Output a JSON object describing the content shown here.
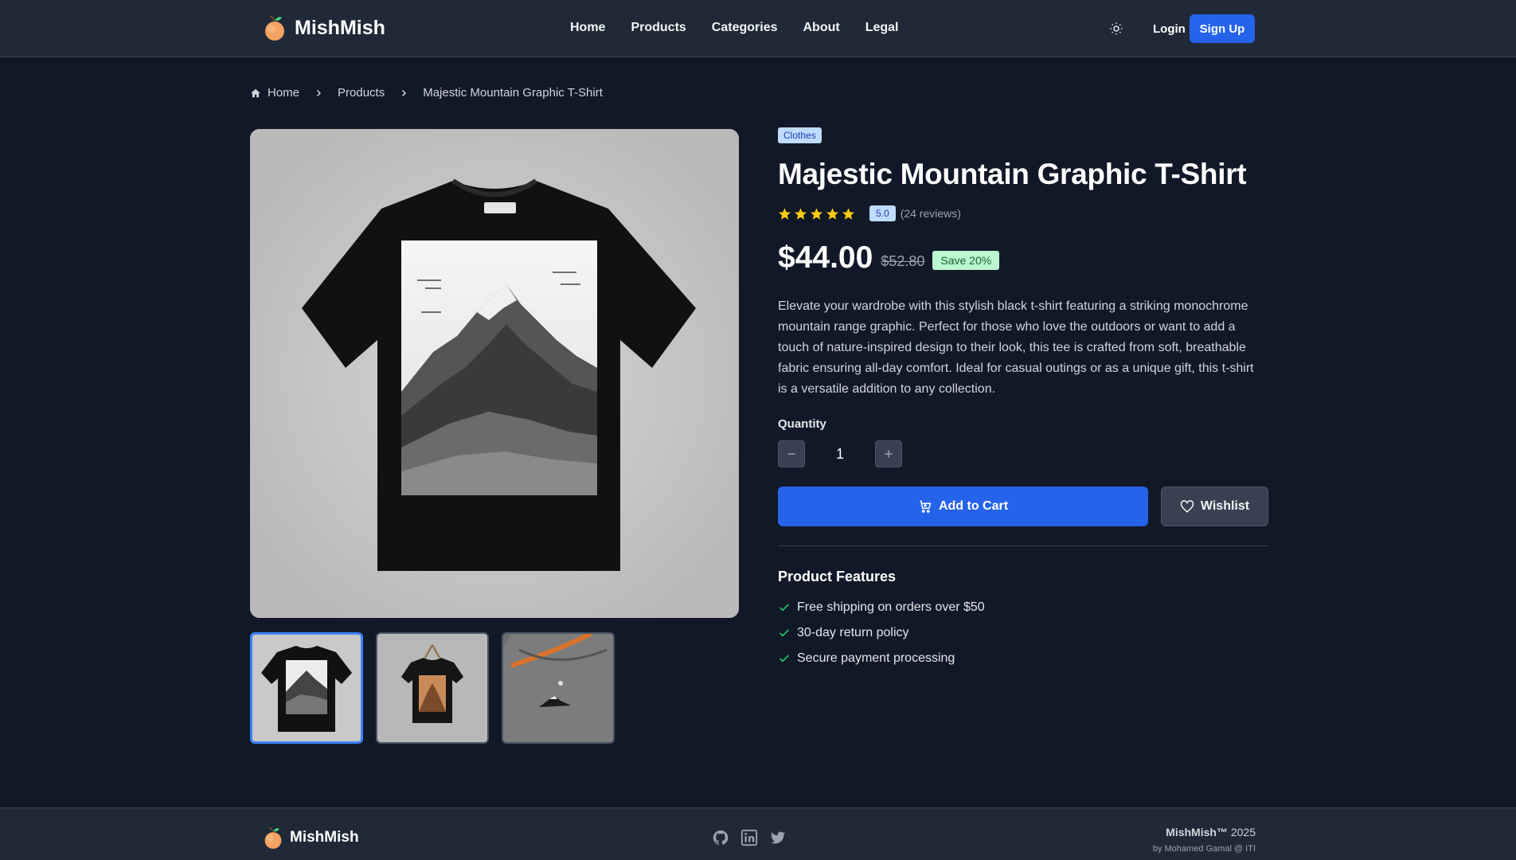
{
  "brand": {
    "name": "MishMish",
    "accent": "#2563eb",
    "logo_color": "#f4a261"
  },
  "nav": {
    "items": [
      "Home",
      "Products",
      "Categories",
      "About",
      "Legal"
    ]
  },
  "header": {
    "theme_icon": "sun-icon",
    "login": "Login",
    "signup": "Sign Up"
  },
  "breadcrumb": {
    "home": "Home",
    "products": "Products",
    "current": "Majestic Mountain Graphic T-Shirt"
  },
  "product": {
    "category": "Clothes",
    "title": "Majestic Mountain Graphic T-Shirt",
    "rating_value": "5.0",
    "rating_stars": 5,
    "reviews": "(24 reviews)",
    "price": "$44.00",
    "old_price": "$52.80",
    "save": "Save 20%",
    "description": "Elevate your wardrobe with this stylish black t-shirt featuring a striking monochrome mountain range graphic. Perfect for those who love the outdoors or want to add a touch of nature-inspired design to their look, this tee is crafted from soft, breathable fabric ensuring all-day comfort. Ideal for casual outings or as a unique gift, this t-shirt is a versatile addition to any collection.",
    "quantity_label": "Quantity",
    "quantity": "1",
    "add_to_cart": "Add to Cart",
    "wishlist": "Wishlist",
    "features_title": "Product Features",
    "features": [
      "Free shipping on orders over $50",
      "30-day return policy",
      "Secure payment processing"
    ]
  },
  "gallery": {
    "thumbnail_count": 3,
    "active_index": 0
  },
  "footer": {
    "brand": "MishMish",
    "copyright_brand": "MishMish™",
    "year": "2025",
    "credit": "by Mohamed Gamal @ ITI",
    "socials": [
      "github-icon",
      "linkedin-icon",
      "twitter-icon"
    ]
  }
}
